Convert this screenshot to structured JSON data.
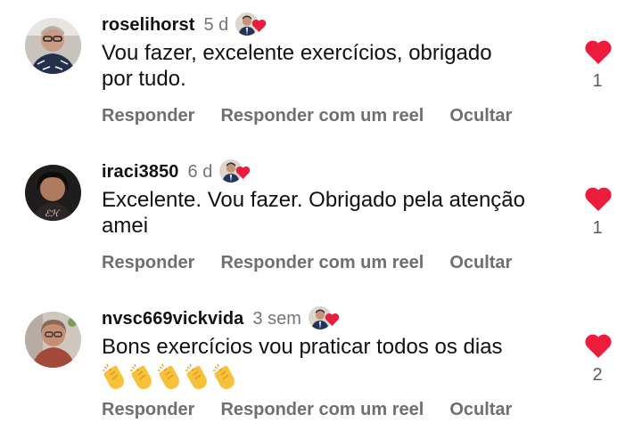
{
  "comments": [
    {
      "username": "roselihorst",
      "time": "5 d",
      "text": "Vou fazer, excelente exercícios, obrigado\npor tudo.",
      "likes": "1",
      "actions": {
        "reply": "Responder",
        "reply_reel": "Responder com um reel",
        "hide": "Ocultar"
      },
      "liked": true
    },
    {
      "username": "iraci3850",
      "time": "6 d",
      "text": "Excelente. Vou fazer. Obrigado pela atenção\namei",
      "likes": "1",
      "actions": {
        "reply": "Responder",
        "reply_reel": "Responder com um reel",
        "hide": "Ocultar"
      },
      "liked": true
    },
    {
      "username": "nvsc669vickvida",
      "time": "3 sem",
      "text": "Bons exercícios vou praticar todos os dias",
      "emoji": "clapping-hands x5",
      "likes": "2",
      "actions": {
        "reply": "Responder",
        "reply_reel": "Responder com um reel",
        "hide": "Ocultar"
      },
      "liked": true
    }
  ],
  "icons": {
    "like": "heart-icon",
    "author_like": "author-liked-icon",
    "emoji": "clapping-hands-icon"
  },
  "colors": {
    "heart": "#ed1c3c",
    "secondary_text": "#757575",
    "background": "#ffffff"
  }
}
